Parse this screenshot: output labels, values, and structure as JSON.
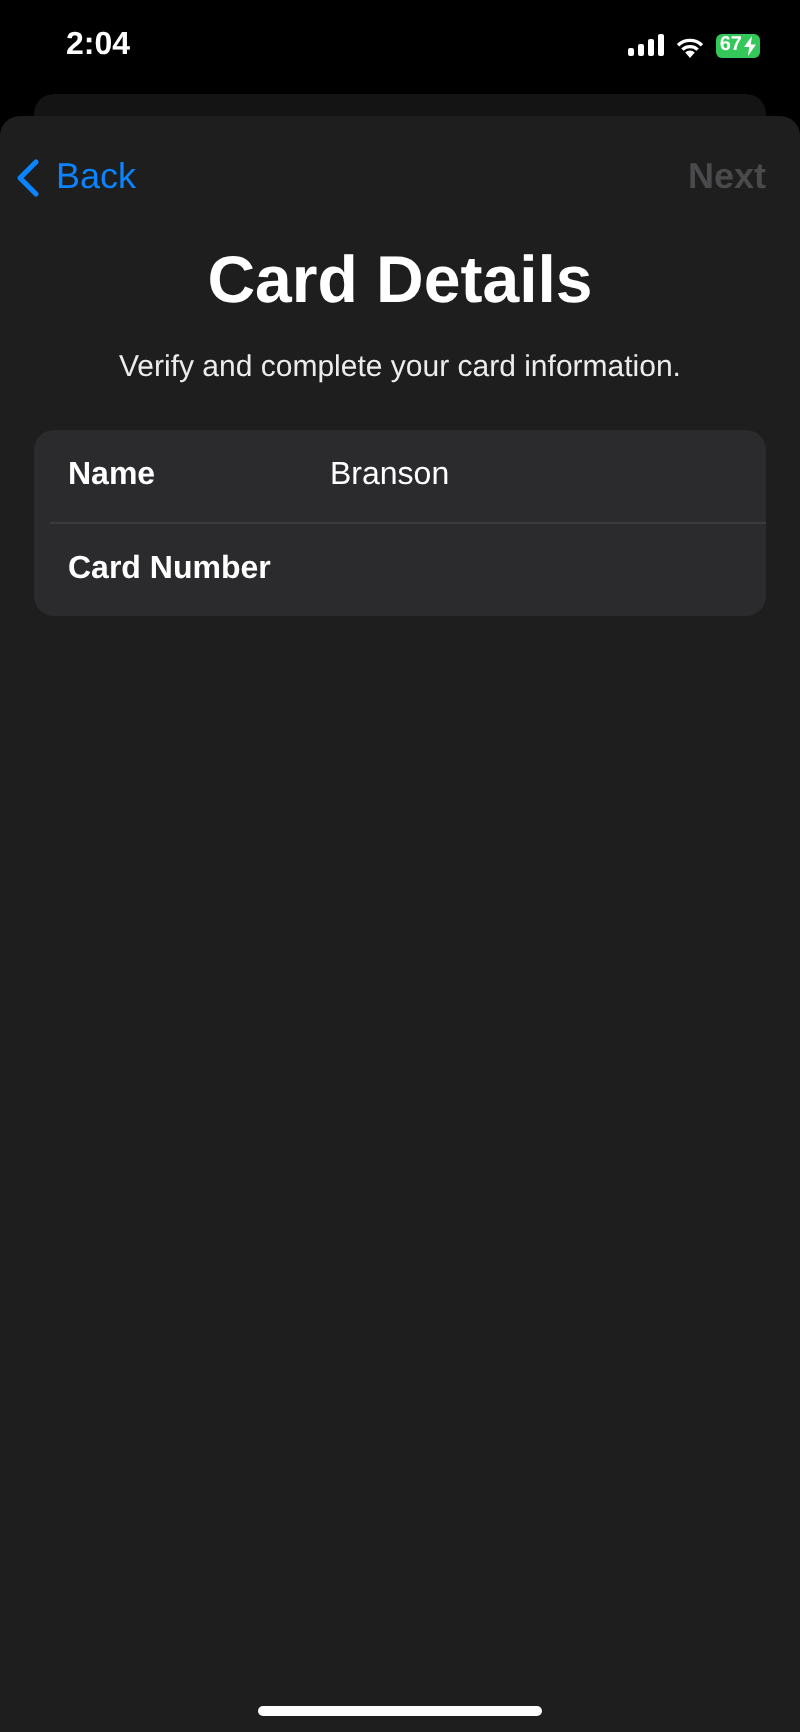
{
  "status_bar": {
    "time": "2:04",
    "battery": "67",
    "charging": true
  },
  "nav": {
    "back": "Back",
    "next": {
      "label": "Next",
      "disabled": true
    }
  },
  "title": "Card Details",
  "subtitle": "Verify and complete your card information.",
  "fields": [
    {
      "label": "Name",
      "value": "Branson"
    },
    {
      "label": "Card Number"
    }
  ]
}
